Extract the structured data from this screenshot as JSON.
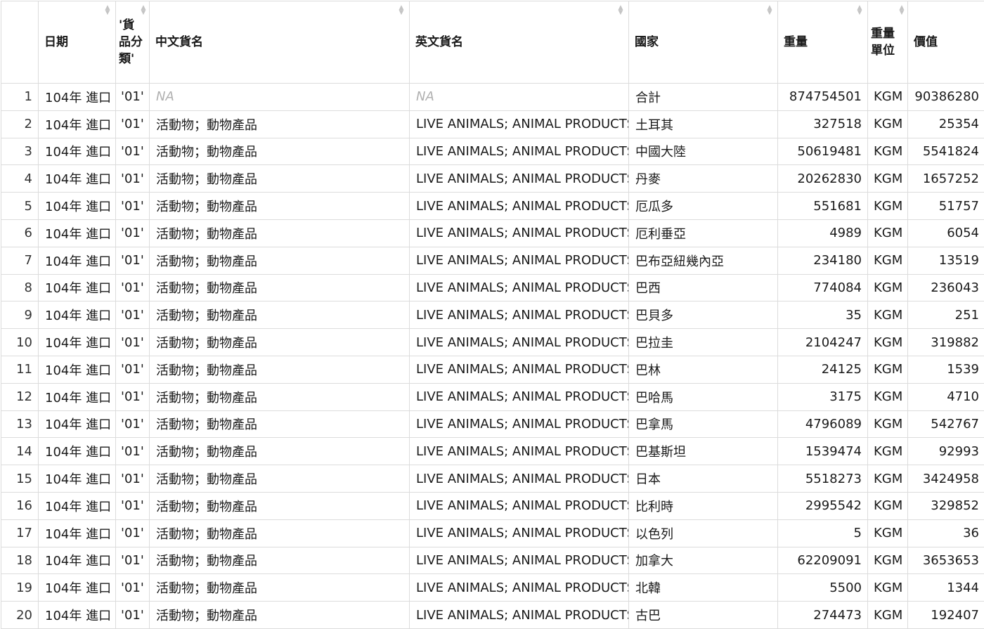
{
  "columns": [
    {
      "label": ""
    },
    {
      "label": "日期"
    },
    {
      "label": "'貨品分類'"
    },
    {
      "label": "中文貨名"
    },
    {
      "label": "英文貨名"
    },
    {
      "label": "國家"
    },
    {
      "label": "重量"
    },
    {
      "label": "重量單位"
    },
    {
      "label": "價值"
    }
  ],
  "rows": [
    {
      "idx": "1",
      "date": "104年 進口",
      "cls": "'01'",
      "zh": "NA",
      "en": "NA",
      "country": "合計",
      "weight": "874754501",
      "unit": "KGM",
      "value": "90386280"
    },
    {
      "idx": "2",
      "date": "104年 進口",
      "cls": "'01'",
      "zh": "活動物；動物產品",
      "en": "LIVE ANIMALS; ANIMAL PRODUCTS",
      "country": "土耳其",
      "weight": "327518",
      "unit": "KGM",
      "value": "25354"
    },
    {
      "idx": "3",
      "date": "104年 進口",
      "cls": "'01'",
      "zh": "活動物；動物產品",
      "en": "LIVE ANIMALS; ANIMAL PRODUCTS",
      "country": "中國大陸",
      "weight": "50619481",
      "unit": "KGM",
      "value": "5541824"
    },
    {
      "idx": "4",
      "date": "104年 進口",
      "cls": "'01'",
      "zh": "活動物；動物產品",
      "en": "LIVE ANIMALS; ANIMAL PRODUCTS",
      "country": "丹麥",
      "weight": "20262830",
      "unit": "KGM",
      "value": "1657252"
    },
    {
      "idx": "5",
      "date": "104年 進口",
      "cls": "'01'",
      "zh": "活動物；動物產品",
      "en": "LIVE ANIMALS; ANIMAL PRODUCTS",
      "country": "厄瓜多",
      "weight": "551681",
      "unit": "KGM",
      "value": "51757"
    },
    {
      "idx": "6",
      "date": "104年 進口",
      "cls": "'01'",
      "zh": "活動物；動物產品",
      "en": "LIVE ANIMALS; ANIMAL PRODUCTS",
      "country": "厄利垂亞",
      "weight": "4989",
      "unit": "KGM",
      "value": "6054"
    },
    {
      "idx": "7",
      "date": "104年 進口",
      "cls": "'01'",
      "zh": "活動物；動物產品",
      "en": "LIVE ANIMALS; ANIMAL PRODUCTS",
      "country": "巴布亞紐幾內亞",
      "weight": "234180",
      "unit": "KGM",
      "value": "13519"
    },
    {
      "idx": "8",
      "date": "104年 進口",
      "cls": "'01'",
      "zh": "活動物；動物產品",
      "en": "LIVE ANIMALS; ANIMAL PRODUCTS",
      "country": "巴西",
      "weight": "774084",
      "unit": "KGM",
      "value": "236043"
    },
    {
      "idx": "9",
      "date": "104年 進口",
      "cls": "'01'",
      "zh": "活動物；動物產品",
      "en": "LIVE ANIMALS; ANIMAL PRODUCTS",
      "country": "巴貝多",
      "weight": "35",
      "unit": "KGM",
      "value": "251"
    },
    {
      "idx": "10",
      "date": "104年 進口",
      "cls": "'01'",
      "zh": "活動物；動物產品",
      "en": "LIVE ANIMALS; ANIMAL PRODUCTS",
      "country": "巴拉圭",
      "weight": "2104247",
      "unit": "KGM",
      "value": "319882"
    },
    {
      "idx": "11",
      "date": "104年 進口",
      "cls": "'01'",
      "zh": "活動物；動物產品",
      "en": "LIVE ANIMALS; ANIMAL PRODUCTS",
      "country": "巴林",
      "weight": "24125",
      "unit": "KGM",
      "value": "1539"
    },
    {
      "idx": "12",
      "date": "104年 進口",
      "cls": "'01'",
      "zh": "活動物；動物產品",
      "en": "LIVE ANIMALS; ANIMAL PRODUCTS",
      "country": "巴哈馬",
      "weight": "3175",
      "unit": "KGM",
      "value": "4710"
    },
    {
      "idx": "13",
      "date": "104年 進口",
      "cls": "'01'",
      "zh": "活動物；動物產品",
      "en": "LIVE ANIMALS; ANIMAL PRODUCTS",
      "country": "巴拿馬",
      "weight": "4796089",
      "unit": "KGM",
      "value": "542767"
    },
    {
      "idx": "14",
      "date": "104年 進口",
      "cls": "'01'",
      "zh": "活動物；動物產品",
      "en": "LIVE ANIMALS; ANIMAL PRODUCTS",
      "country": "巴基斯坦",
      "weight": "1539474",
      "unit": "KGM",
      "value": "92993"
    },
    {
      "idx": "15",
      "date": "104年 進口",
      "cls": "'01'",
      "zh": "活動物；動物產品",
      "en": "LIVE ANIMALS; ANIMAL PRODUCTS",
      "country": "日本",
      "weight": "5518273",
      "unit": "KGM",
      "value": "3424958"
    },
    {
      "idx": "16",
      "date": "104年 進口",
      "cls": "'01'",
      "zh": "活動物；動物產品",
      "en": "LIVE ANIMALS; ANIMAL PRODUCTS",
      "country": "比利時",
      "weight": "2995542",
      "unit": "KGM",
      "value": "329852"
    },
    {
      "idx": "17",
      "date": "104年 進口",
      "cls": "'01'",
      "zh": "活動物；動物產品",
      "en": "LIVE ANIMALS; ANIMAL PRODUCTS",
      "country": "以色列",
      "weight": "5",
      "unit": "KGM",
      "value": "36"
    },
    {
      "idx": "18",
      "date": "104年 進口",
      "cls": "'01'",
      "zh": "活動物；動物產品",
      "en": "LIVE ANIMALS; ANIMAL PRODUCTS",
      "country": "加拿大",
      "weight": "62209091",
      "unit": "KGM",
      "value": "3653653"
    },
    {
      "idx": "19",
      "date": "104年 進口",
      "cls": "'01'",
      "zh": "活動物；動物產品",
      "en": "LIVE ANIMALS; ANIMAL PRODUCTS",
      "country": "北韓",
      "weight": "5500",
      "unit": "KGM",
      "value": "1344"
    },
    {
      "idx": "20",
      "date": "104年 進口",
      "cls": "'01'",
      "zh": "活動物；動物產品",
      "en": "LIVE ANIMALS; ANIMAL PRODUCTS",
      "country": "古巴",
      "weight": "274473",
      "unit": "KGM",
      "value": "192407"
    }
  ]
}
